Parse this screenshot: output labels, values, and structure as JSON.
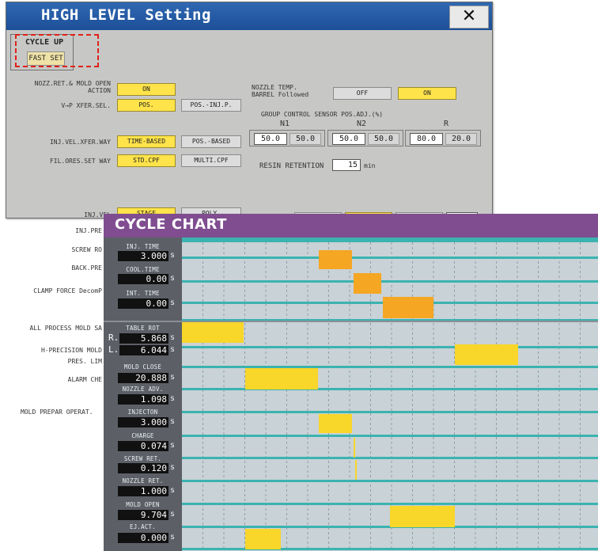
{
  "high_level": {
    "title": "HIGH LEVEL Setting",
    "close_glyph": "✕",
    "cycle_up": {
      "label": "CYCLE UP",
      "fast_set": "FAST SET"
    },
    "rows": [
      {
        "label": "NOZZ.RET.& MOLD OPEN\nACTION",
        "opt1": "ON"
      },
      {
        "label": "V→P XFER.SEL.",
        "opt1": "POS.",
        "opt2": "POS.-INJ.P."
      },
      {
        "label": "INJ.VEL.XFER.WAY",
        "opt1": "TIME-BASED",
        "opt2": "POS.-BASED"
      },
      {
        "label": "FIL.ORES.SET WAY",
        "opt1": "STD.CPF",
        "opt2": "MULTI.CPF"
      },
      {
        "label": "INJ.VEL",
        "opt1": "STAGE",
        "opt2": "POLY."
      }
    ],
    "nozzle_temp": {
      "label": "NOZZLE TEMP.\nBARREL Followed",
      "off": "OFF",
      "on": "ON"
    },
    "group_control": {
      "header": "GROUP CONTROL  SENSOR POS.ADJ.(%)",
      "columns": [
        "N1",
        "N2",
        "R"
      ],
      "values": [
        [
          "50.0",
          "50.0"
        ],
        [
          "50.0",
          "50.0"
        ],
        [
          "80.0",
          "20.0"
        ]
      ]
    },
    "resin_retention": {
      "label": "RESIN RETENTION",
      "value": "15",
      "unit": "min"
    },
    "partial_labels": [
      "INJ.PRE",
      "SCREW RO",
      "BACK.PRE",
      "CLAMP FORCE DecomP",
      "ALL PROCESS MOLD SA",
      "H-PRECISION MOLD",
      "PRES. LIM",
      "ALARM CHE",
      "MOLD PREPAR OPERAT."
    ]
  },
  "cycle_chart": {
    "title": "CYCLE CHART",
    "top_items": [
      {
        "name": "INJ. TIME",
        "value": "3.000",
        "unit": "s"
      },
      {
        "name": "COOL.TIME",
        "value": "0.00",
        "unit": "s"
      },
      {
        "name": "INT. TIME",
        "value": "0.00",
        "unit": "s"
      }
    ],
    "table_rot": {
      "name": "TABLE ROT",
      "r_label": "R.",
      "r_value": "5.868",
      "l_label": "L.",
      "l_value": "6.044",
      "unit": "s"
    },
    "items": [
      {
        "name": "MOLD CLOSE",
        "value": "20.888",
        "unit": "s"
      },
      {
        "name": "NOZZLE ADV.",
        "value": "1.098",
        "unit": "s"
      },
      {
        "name": "INJECTON",
        "value": "3.000",
        "unit": "s"
      },
      {
        "name": "CHARGE",
        "value": "0.074",
        "unit": "s"
      },
      {
        "name": "SCREW RET.",
        "value": "0.120",
        "unit": "s"
      },
      {
        "name": "NOZZLE RET.",
        "value": "1.000",
        "unit": "s"
      },
      {
        "name": "MOLD OPEN",
        "value": "9.704",
        "unit": "s"
      },
      {
        "name": "EJ.ACT.",
        "value": "0.000",
        "unit": "s"
      }
    ],
    "colors": {
      "orange_bar": "#f5a623",
      "yellow_bar": "#f8d62a",
      "track": "#3bb3b0",
      "title_bar": "#7f4d90"
    }
  }
}
